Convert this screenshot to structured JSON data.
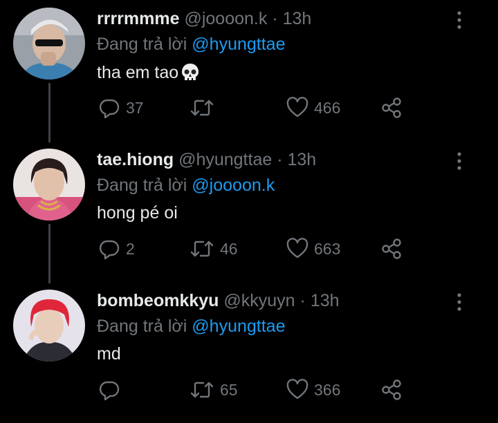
{
  "tweets": [
    {
      "name": "rrrrmmme",
      "handle": "@joooon.k",
      "separator": "·",
      "time": "13h",
      "reply_prefix": "Đang trả lời",
      "reply_to": "@hyungttae",
      "text": "tha em tao",
      "emoji": "skull-icon",
      "replies": "37",
      "retweets": "",
      "likes": "466",
      "avatar_bg": "#8a8f99"
    },
    {
      "name": "tae.hiong",
      "handle": "@hyungttae",
      "separator": "·",
      "time": "13h",
      "reply_prefix": "Đang trả lời",
      "reply_to": "@joooon.k",
      "text": "hong pé oi",
      "emoji": "",
      "replies": "2",
      "retweets": "46",
      "likes": "663",
      "avatar_bg": "#c45a7a"
    },
    {
      "name": "bombeomkkyu",
      "handle": "@kkyuyn",
      "separator": "·",
      "time": "13h",
      "reply_prefix": "Đang trả lời",
      "reply_to": "@hyungttae",
      "text": "md",
      "emoji": "",
      "replies": "",
      "retweets": "65",
      "likes": "366",
      "avatar_bg": "#d8d3e0"
    }
  ],
  "colors": {
    "background": "#000000",
    "mention": "#1d9bf0",
    "muted": "#71767b",
    "text": "#e7e9ea",
    "thread_line": "#3d4248"
  }
}
